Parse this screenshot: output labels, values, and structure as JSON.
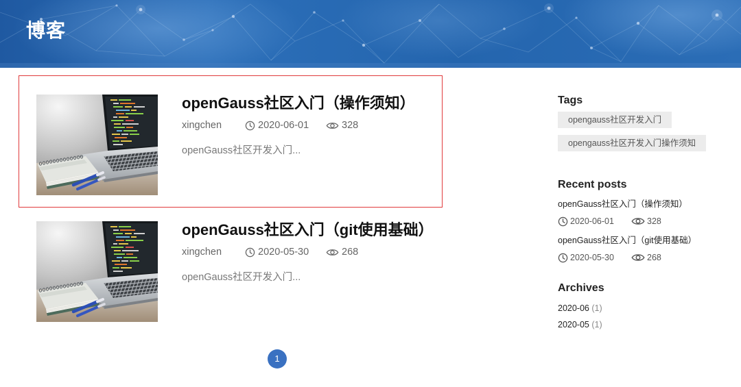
{
  "header": {
    "title": "博客"
  },
  "posts": [
    {
      "title": "openGauss社区入门（操作须知）",
      "author": "xingchen",
      "date": "2020-06-01",
      "views": "328",
      "excerpt": "openGauss社区开发入门...",
      "thumbnail_icon": "laptop-desk-photo"
    },
    {
      "title": "openGauss社区入门（git使用基础）",
      "author": "xingchen",
      "date": "2020-05-30",
      "views": "268",
      "excerpt": "openGauss社区开发入门...",
      "thumbnail_icon": "laptop-desk-photo"
    }
  ],
  "pagination": {
    "current_page": "1"
  },
  "sidebar": {
    "tags": {
      "heading": "Tags",
      "items": [
        "opengauss社区开发入门",
        "opengauss社区开发入门操作须知"
      ]
    },
    "recent_posts": {
      "heading": "Recent posts",
      "items": [
        {
          "title": "openGauss社区入门（操作须知）",
          "date": "2020-06-01",
          "views": "328"
        },
        {
          "title": "openGauss社区入门（git使用基础）",
          "date": "2020-05-30",
          "views": "268"
        }
      ]
    },
    "archives": {
      "heading": "Archives",
      "items": [
        {
          "month": "2020-06",
          "count": "(1)"
        },
        {
          "month": "2020-05",
          "count": "(1)"
        }
      ]
    }
  },
  "icons": {
    "date": "clock-icon",
    "views": "eye-icon"
  },
  "colors": {
    "header_blue": "#2a68b0",
    "accent": "#3a71c1",
    "highlight_border": "#e0393b",
    "tag_bg": "#ececec"
  }
}
